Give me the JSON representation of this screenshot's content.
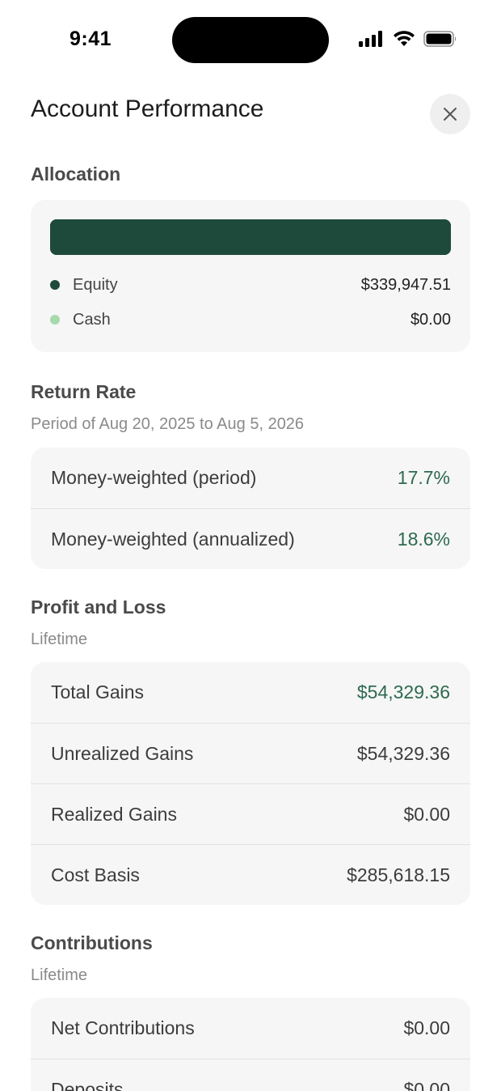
{
  "status_bar": {
    "time": "9:41"
  },
  "header": {
    "title": "Account Performance"
  },
  "allocation": {
    "title": "Allocation",
    "equity_share": 1.0,
    "legend": [
      {
        "label": "Equity",
        "value": "$339,947.51",
        "color": "#1e4a3b"
      },
      {
        "label": "Cash",
        "value": "$0.00",
        "color": "#a6d9ab"
      }
    ]
  },
  "return_rate": {
    "title": "Return Rate",
    "subtitle": "Period of Aug 20, 2025 to Aug 5, 2026",
    "rows": [
      {
        "label": "Money-weighted (period)",
        "value": "17.7%"
      },
      {
        "label": "Money-weighted (annualized)",
        "value": "18.6%"
      }
    ]
  },
  "profit_loss": {
    "title": "Profit and Loss",
    "subtitle": "Lifetime",
    "rows": [
      {
        "label": "Total Gains",
        "value": "$54,329.36"
      },
      {
        "label": "Unrealized Gains",
        "value": "$54,329.36"
      },
      {
        "label": "Realized Gains",
        "value": "$0.00"
      },
      {
        "label": "Cost Basis",
        "value": "$285,618.15"
      }
    ]
  },
  "contributions": {
    "title": "Contributions",
    "subtitle": "Lifetime",
    "rows": [
      {
        "label": "Net Contributions",
        "value": "$0.00"
      },
      {
        "label": "Deposits",
        "value": "$0.00"
      }
    ]
  },
  "colors": {
    "accent_green": "#2e6a4f",
    "bar_green": "#1e4a3b",
    "cash_dot": "#a6d9ab"
  }
}
